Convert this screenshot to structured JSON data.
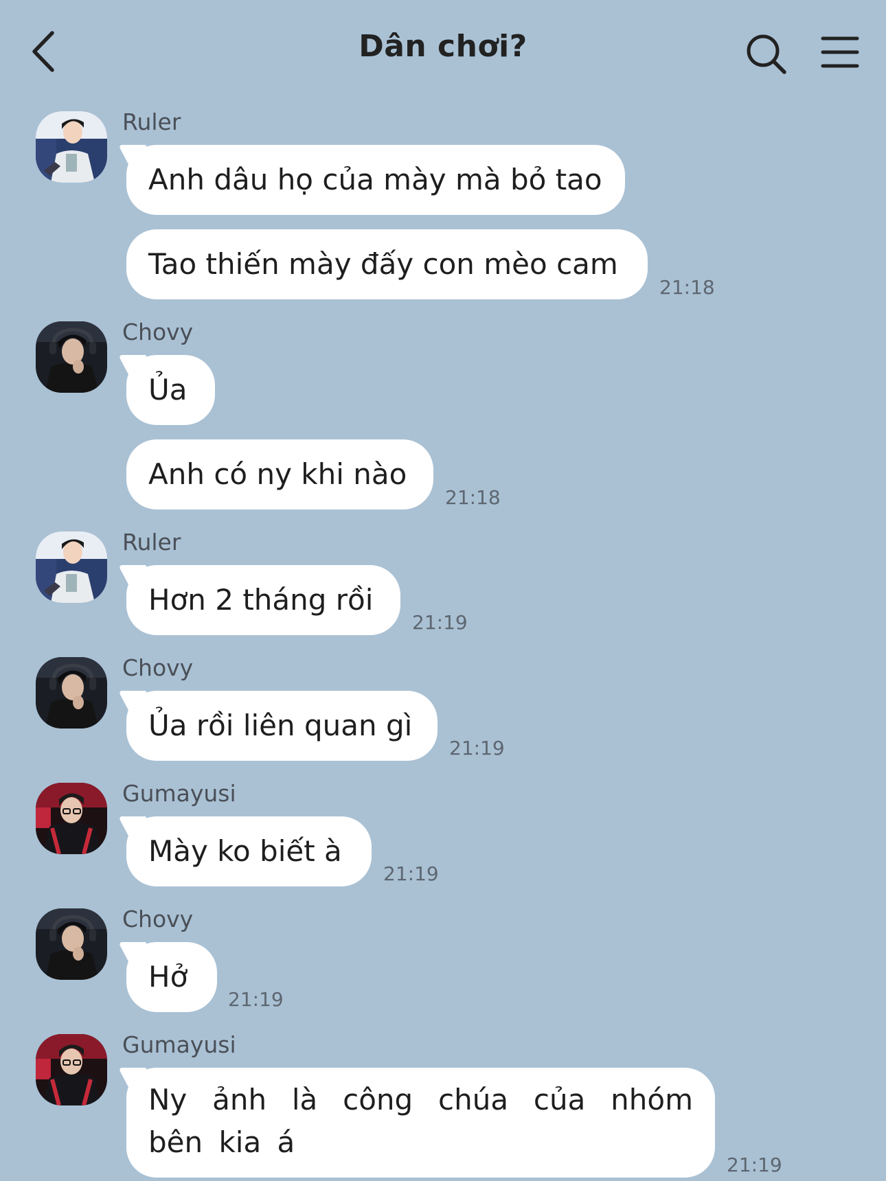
{
  "header": {
    "title": "Dân chơi?"
  },
  "messages": [
    {
      "sender": "Ruler",
      "bubbles": [
        "Anh dâu họ của mày mà bỏ tao",
        "Tao thiến mày đấy con mèo cam"
      ],
      "time": "21:18"
    },
    {
      "sender": "Chovy",
      "bubbles": [
        "Ủa",
        "Anh có ny khi nào"
      ],
      "time": "21:18"
    },
    {
      "sender": "Ruler",
      "bubbles": [
        "Hơn 2 tháng rồi"
      ],
      "time": "21:19"
    },
    {
      "sender": "Chovy",
      "bubbles": [
        "Ủa rồi liên quan gì"
      ],
      "time": "21:19"
    },
    {
      "sender": "Gumayusi",
      "bubbles": [
        "Mày ko biết à"
      ],
      "time": "21:19"
    },
    {
      "sender": "Chovy",
      "bubbles": [
        "Hở"
      ],
      "time": "21:19"
    },
    {
      "sender": "Gumayusi",
      "bubbles": [
        "Ny ảnh là công chúa của nhóm bên kia á"
      ],
      "time": "21:19"
    }
  ]
}
